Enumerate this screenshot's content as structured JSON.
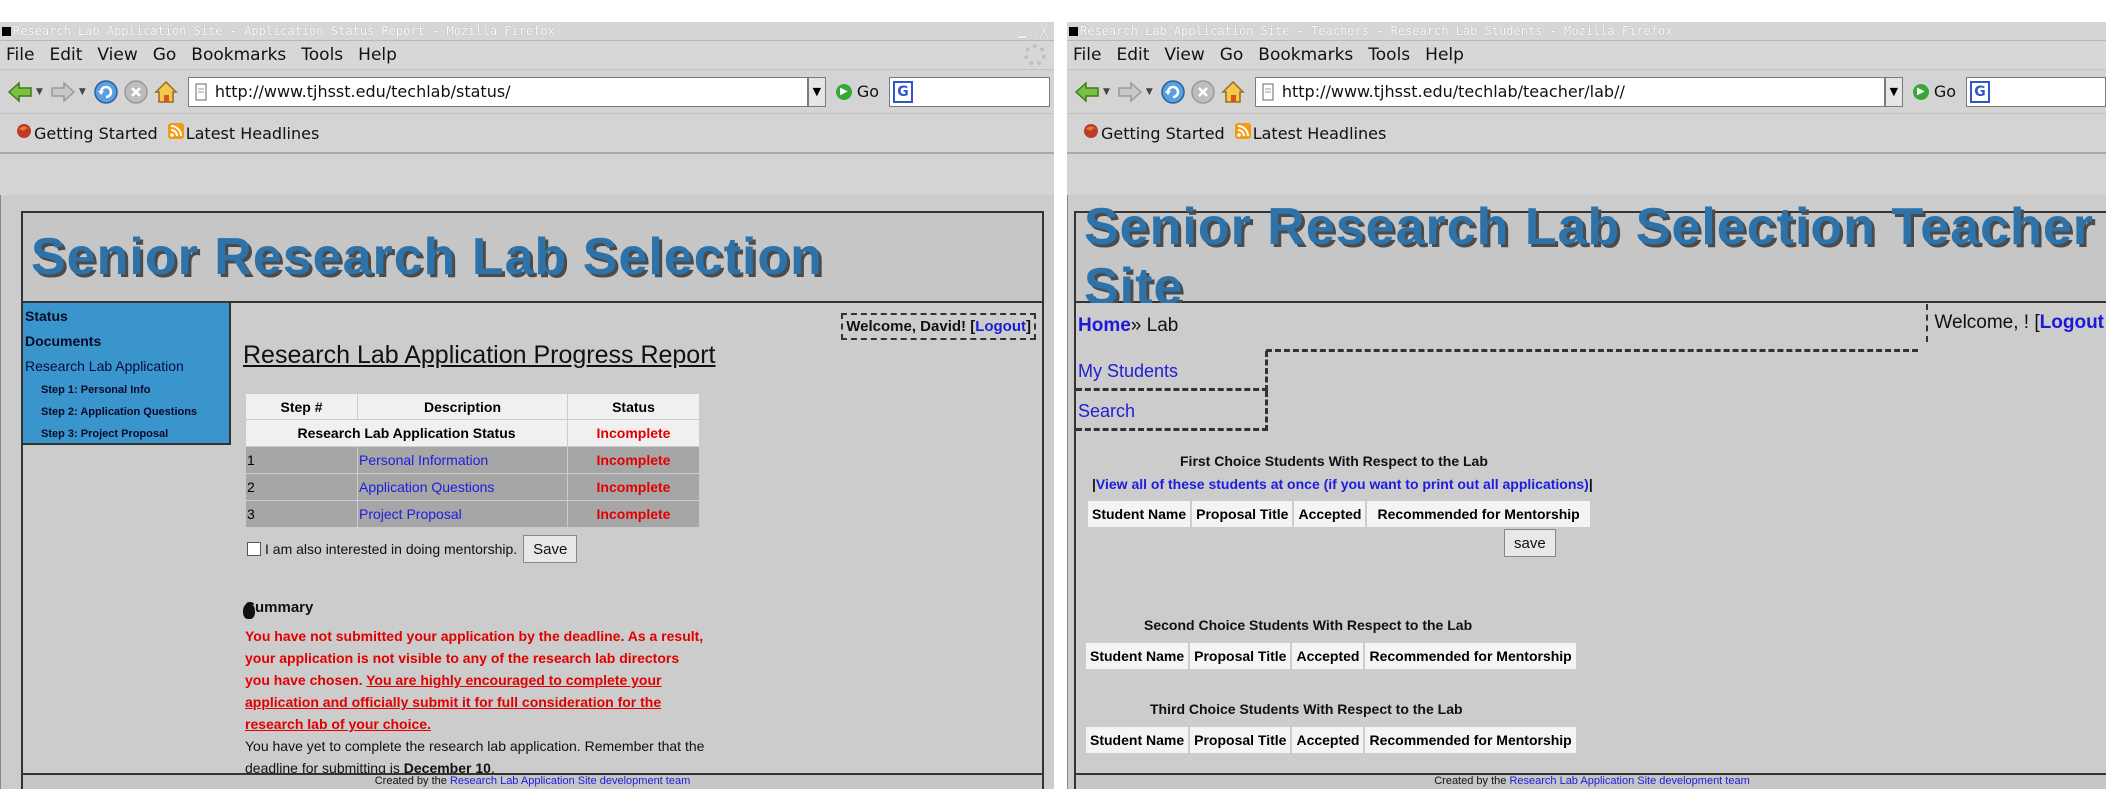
{
  "left_window": {
    "title": "Research Lab Application Site - Application Status Report - Mozilla Firefox",
    "menu": [
      "File",
      "Edit",
      "View",
      "Go",
      "Bookmarks",
      "Tools",
      "Help"
    ],
    "url": "http://www.tjhsst.edu/techlab/status/",
    "go_label": "Go",
    "bookmarks": [
      "Getting Started",
      "Latest Headlines"
    ],
    "banner_title": "Senior Research Lab Selection",
    "sidebar": {
      "status": "Status",
      "documents": "Documents",
      "application": "Research Lab Application",
      "step1": "Step 1: Personal Info",
      "step2": "Step 2: Application Questions",
      "step3": "Step 3: Project Proposal"
    },
    "welcome": {
      "text": "Welcome, David! [",
      "logout": "Logout",
      "close": "]"
    },
    "heading": "Research Lab Application Progress Report",
    "table": {
      "headers": [
        "Step #",
        "Description",
        "Status"
      ],
      "summary_row": {
        "description": "Research Lab Application Status",
        "status": "Incomplete"
      },
      "rows": [
        {
          "step": "1",
          "description": "Personal Information",
          "status": "Incomplete"
        },
        {
          "step": "2",
          "description": "Application Questions",
          "status": "Incomplete"
        },
        {
          "step": "3",
          "description": "Project Proposal",
          "status": "Incomplete"
        }
      ]
    },
    "mentorship_label": "I am also interested in doing mentorship.",
    "save_label": "Save",
    "summary_title": "Summary",
    "summary_red_1": "You have not submitted your application by the deadline. As a result, your application is not visible to any of the research lab directors you have chosen. ",
    "summary_red_2": "You are highly encouraged to complete your application and officially submit it for full consideration for the research lab of your choice.",
    "summary_black": "You have yet to complete the research lab application. Remember that the deadline for submitting is ",
    "deadline": "December 10",
    "deadline_end": ".",
    "footer_text": "Created by the ",
    "footer_link": "Research Lab Application Site development team"
  },
  "right_window": {
    "title": "Research Lab Application Site - Teachers - Research Lab Students - Mozilla Firefox",
    "menu": [
      "File",
      "Edit",
      "View",
      "Go",
      "Bookmarks",
      "Tools",
      "Help"
    ],
    "url": "http://www.tjhsst.edu/techlab/teacher/lab//",
    "go_label": "Go",
    "bookmarks": [
      "Getting Started",
      "Latest Headlines"
    ],
    "banner_title": "Senior Research Lab Selection Teacher Site",
    "breadcrumb": {
      "home": "Home",
      "sep": "» ",
      "current": "Lab"
    },
    "welcome": {
      "text": "Welcome, ! [",
      "logout": "Logout"
    },
    "nav": [
      "My Students",
      "Search"
    ],
    "first_title": "First Choice Students With Respect to the Lab",
    "view_all": "View all of these students at once (if you want to print out all applications)",
    "second_title": "Second Choice Students With Respect to the Lab",
    "third_title": "Third Choice Students With Respect to the Lab",
    "table_headers": [
      "Student Name",
      "Proposal Title",
      "Accepted",
      "Recommended for Mentorship"
    ],
    "save_label": "save",
    "footer_text": "Created by the ",
    "footer_link": "Research Lab Application Site development team"
  },
  "colors": {
    "accent_blue": "#2d72a8",
    "sidebar_blue": "#3a95cc",
    "incomplete_red": "#e00000",
    "link_blue": "#1c1ce0"
  }
}
